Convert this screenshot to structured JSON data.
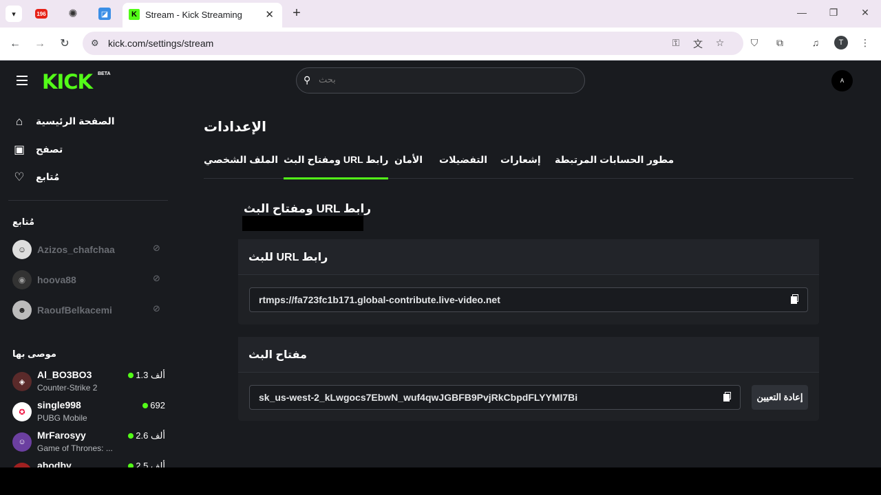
{
  "browser": {
    "pinned_badge": "196",
    "active_tab_title": "Stream - Kick Streaming",
    "url": "kick.com/settings/stream",
    "profile_initial": "T"
  },
  "header": {
    "logo": "KICK",
    "logo_badge": "BETA",
    "search_placeholder": "بحث",
    "avatar_initial": "A"
  },
  "sidebar": {
    "nav": [
      {
        "label": "الصفحة الرئيسية",
        "icon": "home-icon"
      },
      {
        "label": "تصفح",
        "icon": "browse-icon"
      },
      {
        "label": "مُتابع",
        "icon": "heart-icon"
      }
    ],
    "following_heading": "مُتابع",
    "following": [
      {
        "name": "Azizos_chafchaa"
      },
      {
        "name": "hoova88"
      },
      {
        "name": "RaoufBelkacemi"
      }
    ],
    "recommended_heading": "موصى بها",
    "recommended": [
      {
        "name": "Al_BO3BO3",
        "category": "Counter-Strike 2",
        "viewers": "1.3 ألف"
      },
      {
        "name": "single998",
        "category": "PUBG Mobile",
        "viewers": "692"
      },
      {
        "name": "MrFarosyy",
        "category": "Game of Thrones: ...",
        "viewers": "2.6 ألف"
      },
      {
        "name": "abodby",
        "category": "",
        "viewers": "2.5 ألف"
      }
    ]
  },
  "settings": {
    "title": "الإعدادات",
    "tabs": [
      {
        "label": "الملف الشخصي"
      },
      {
        "label": "ومفتاح البث URL رابط",
        "active": true
      },
      {
        "label": "الأمان"
      },
      {
        "label": "التفضيلات"
      },
      {
        "label": "إشعارات"
      },
      {
        "label": "الحسابات المرتبطة"
      },
      {
        "label": "مطور"
      }
    ],
    "section_title": "ومفتاح البث URL رابط",
    "stream_url_card": {
      "title": "للبث URL رابط",
      "value": "rtmps://fa723fc1b171.global-contribute.live-video.net"
    },
    "stream_key_card": {
      "title": "مفتاح البث",
      "value": "sk_us-west-2_kLwgocs7EbwN_wuf4qwJGBFB9PvjRkCbpdFLYYMI7Bi",
      "reset_label": "إعادة التعيين"
    }
  },
  "colors": {
    "accent": "#53fc18",
    "background": "#191b1f",
    "card": "#1f2125"
  }
}
